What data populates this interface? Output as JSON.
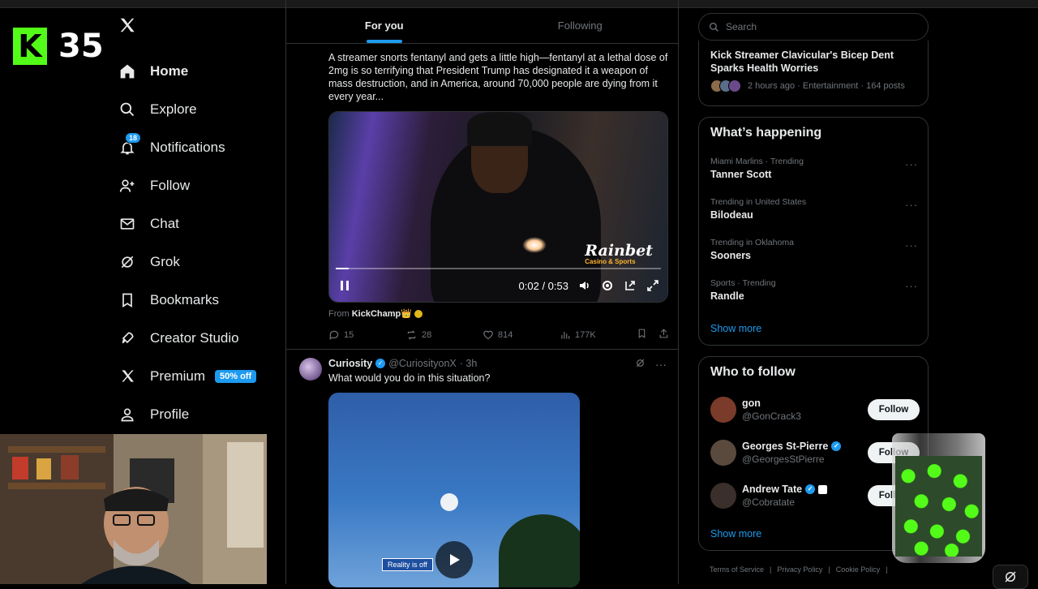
{
  "stream_overlay": {
    "count": "35",
    "logo_letter": "K"
  },
  "nav": {
    "items": [
      {
        "label": "Home",
        "icon": "home-icon"
      },
      {
        "label": "Explore",
        "icon": "search-icon"
      },
      {
        "label": "Notifications",
        "icon": "bell-icon",
        "badge": "18"
      },
      {
        "label": "Follow",
        "icon": "person-plus-icon"
      },
      {
        "label": "Chat",
        "icon": "mail-icon"
      },
      {
        "label": "Grok",
        "icon": "grok-icon"
      },
      {
        "label": "Bookmarks",
        "icon": "bookmark-icon"
      },
      {
        "label": "Creator Studio",
        "icon": "rocket-icon"
      },
      {
        "label": "Premium",
        "icon": "x-icon",
        "promo": "50% off"
      },
      {
        "label": "Profile",
        "icon": "person-icon"
      }
    ]
  },
  "feed": {
    "tabs": [
      {
        "label": "For you"
      },
      {
        "label": "Following"
      }
    ],
    "post1": {
      "text": "A streamer snorts fentanyl and gets a little high—fentanyl at a lethal dose of 2mg is so terrifying that President Trump has designated it a weapon of mass destruction, and in America, around 70,000 people are dying from it every year...",
      "video": {
        "time": "0:02 / 0:53",
        "watermark": "Rainbet",
        "watermark_sub": "Casino & Sports",
        "progress": 0.04
      },
      "from_label": "From",
      "from_name": "KickChamp👑",
      "replies": "15",
      "reposts": "28",
      "likes": "814",
      "views": "177K"
    },
    "post2": {
      "name": "Curiosity",
      "handle": "@CuriosityonX",
      "time": "· 3h",
      "text": "What would you do in this situation?",
      "video_sign": "Reality is off"
    }
  },
  "right": {
    "search_placeholder": "Search",
    "news": {
      "title": "Kick Streamer Clavicular's Bicep Dent Sparks Health Worries",
      "meta": "2 hours ago · Entertainment · 164 posts"
    },
    "happening": {
      "title": "What’s happening",
      "trends": [
        {
          "context": "Miami Marlins · Trending",
          "name": "Tanner Scott"
        },
        {
          "context": "Trending in United States",
          "name": "Bilodeau"
        },
        {
          "context": "Trending in Oklahoma",
          "name": "Sooners"
        },
        {
          "context": "Sports · Trending",
          "name": "Randle"
        }
      ],
      "show_more": "Show more"
    },
    "who_to_follow": {
      "title": "Who to follow",
      "users": [
        {
          "name": "gon",
          "handle": "@GonCrack3",
          "verified": false,
          "button": "Follow",
          "color": "#7a3b2a"
        },
        {
          "name": "Georges St-Pierre",
          "handle": "@GeorgesStPierre",
          "verified": true,
          "button": "Follow",
          "color": "#5a4a3e"
        },
        {
          "name": "Andrew Tate",
          "handle": "@Cobratate",
          "verified": true,
          "button": "Follow",
          "color": "#3a2f2a"
        }
      ],
      "show_more": "Show more"
    },
    "footer": [
      "Terms of Service",
      "|",
      "Privacy Policy",
      "|",
      "Cookie Policy",
      "|"
    ]
  }
}
